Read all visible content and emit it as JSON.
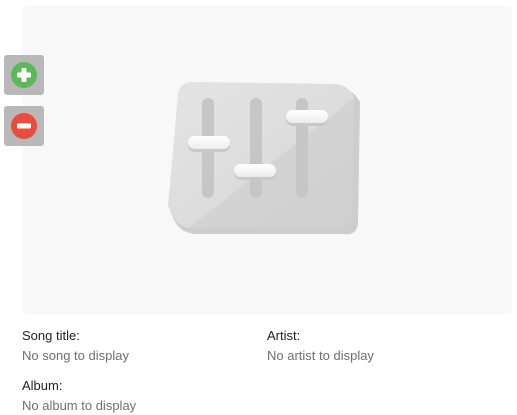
{
  "colors": {
    "panel_bg": "#f8f8f8",
    "side_button_bg": "#b8b8b8",
    "add_accent": "#5cb85c",
    "remove_accent": "#e74c3c",
    "label_text": "#222222",
    "value_text": "#6f6f6f"
  },
  "icons": {
    "art_placeholder": "equalizer-sliders-icon",
    "add": "plus-circle-icon",
    "remove": "minus-circle-icon"
  },
  "song": {
    "label": "Song title:",
    "value": "No song to display"
  },
  "artist": {
    "label": "Artist:",
    "value": "No artist to display"
  },
  "album": {
    "label": "Album:",
    "value": "No album to display"
  }
}
